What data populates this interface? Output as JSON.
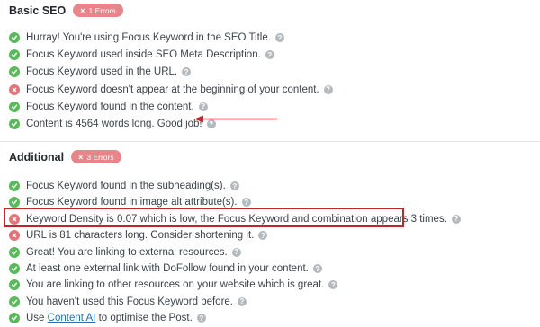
{
  "colors": {
    "pass": "#5bb85b",
    "fail": "#e2757a",
    "badge": "#e8858a",
    "annotation": "#c3252d"
  },
  "basic_seo": {
    "title": "Basic SEO",
    "badge": "1 Errors",
    "items": [
      {
        "status": "pass",
        "text": "Hurray! You're using Focus Keyword in the SEO Title."
      },
      {
        "status": "pass",
        "text": "Focus Keyword used inside SEO Meta Description."
      },
      {
        "status": "pass",
        "text": "Focus Keyword used in the URL."
      },
      {
        "status": "fail",
        "text": "Focus Keyword doesn't appear at the beginning of your content."
      },
      {
        "status": "pass",
        "text": "Focus Keyword found in the content."
      },
      {
        "status": "pass",
        "text": "Content is 4564 words long. Good job!"
      }
    ]
  },
  "additional": {
    "title": "Additional",
    "badge": "3 Errors",
    "items": [
      {
        "status": "pass",
        "text": "Focus Keyword found in the subheading(s)."
      },
      {
        "status": "pass",
        "text": "Focus Keyword found in image alt attribute(s)."
      },
      {
        "status": "fail",
        "text": "Keyword Density is 0.07 which is low, the Focus Keyword and combination appears 3 times."
      },
      {
        "status": "fail",
        "text": "URL is 81 characters long. Consider shortening it."
      },
      {
        "status": "pass",
        "text": "Great! You are linking to external resources."
      },
      {
        "status": "pass",
        "text": "At least one external link with DoFollow found in your content."
      },
      {
        "status": "pass",
        "text": "You are linking to other resources on your website which is great."
      },
      {
        "status": "pass",
        "text": "You haven't used this Focus Keyword before."
      }
    ],
    "last_item": {
      "status": "pass",
      "prefix": "Use ",
      "link": "Content AI",
      "suffix": " to optimise the Post."
    }
  },
  "help_glyph": "?",
  "badge_glyph": "×"
}
